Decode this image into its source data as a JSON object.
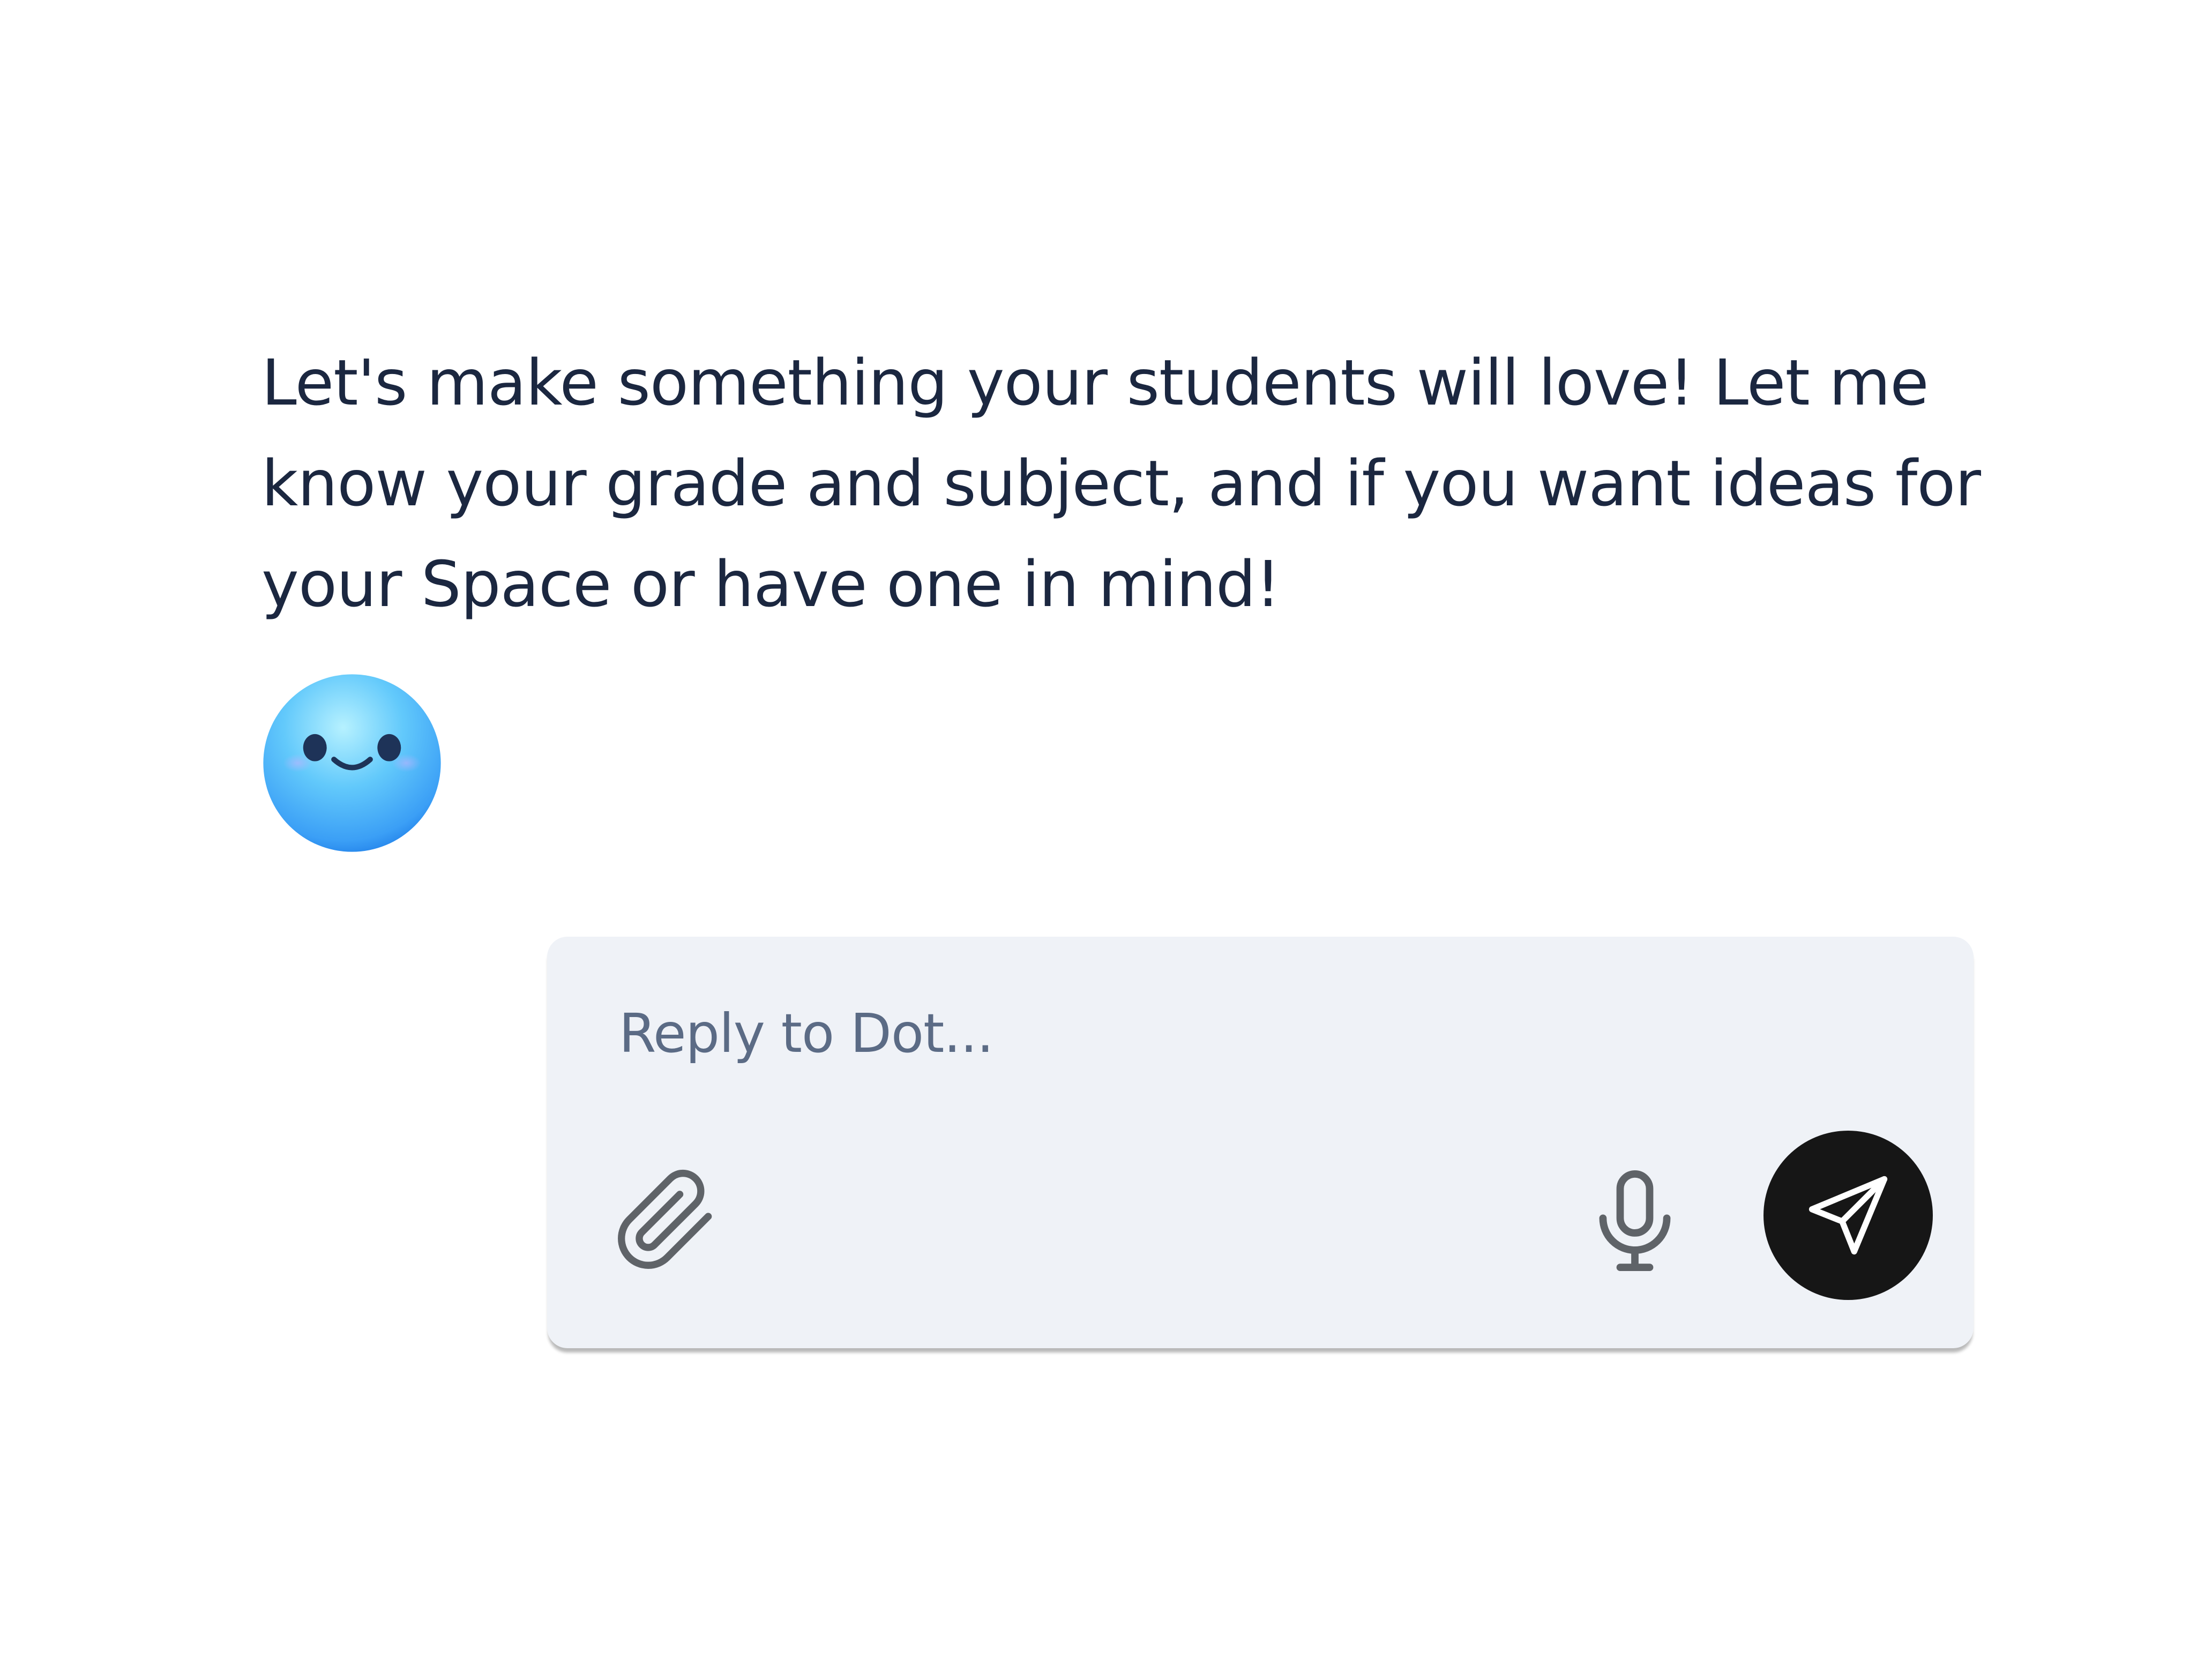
{
  "chat": {
    "assistant_message": "Let's make something your students will love! Let me know your grade and subject, and if you want ideas for your Space or have one in mind!",
    "assistant_avatar_icon": "smiling-face-avatar-icon"
  },
  "composer": {
    "placeholder": "Reply to Dot...",
    "value": "",
    "attach_icon": "paperclip-icon",
    "mic_icon": "microphone-icon",
    "send_icon": "paper-plane-icon"
  },
  "colors": {
    "text": "#1b2740",
    "placeholder": "#5b6b85",
    "composer_background": "#eff2f7",
    "send_button": "#161616",
    "icon_gray": "#5f6368",
    "avatar_blue": "#3aa5f8"
  }
}
